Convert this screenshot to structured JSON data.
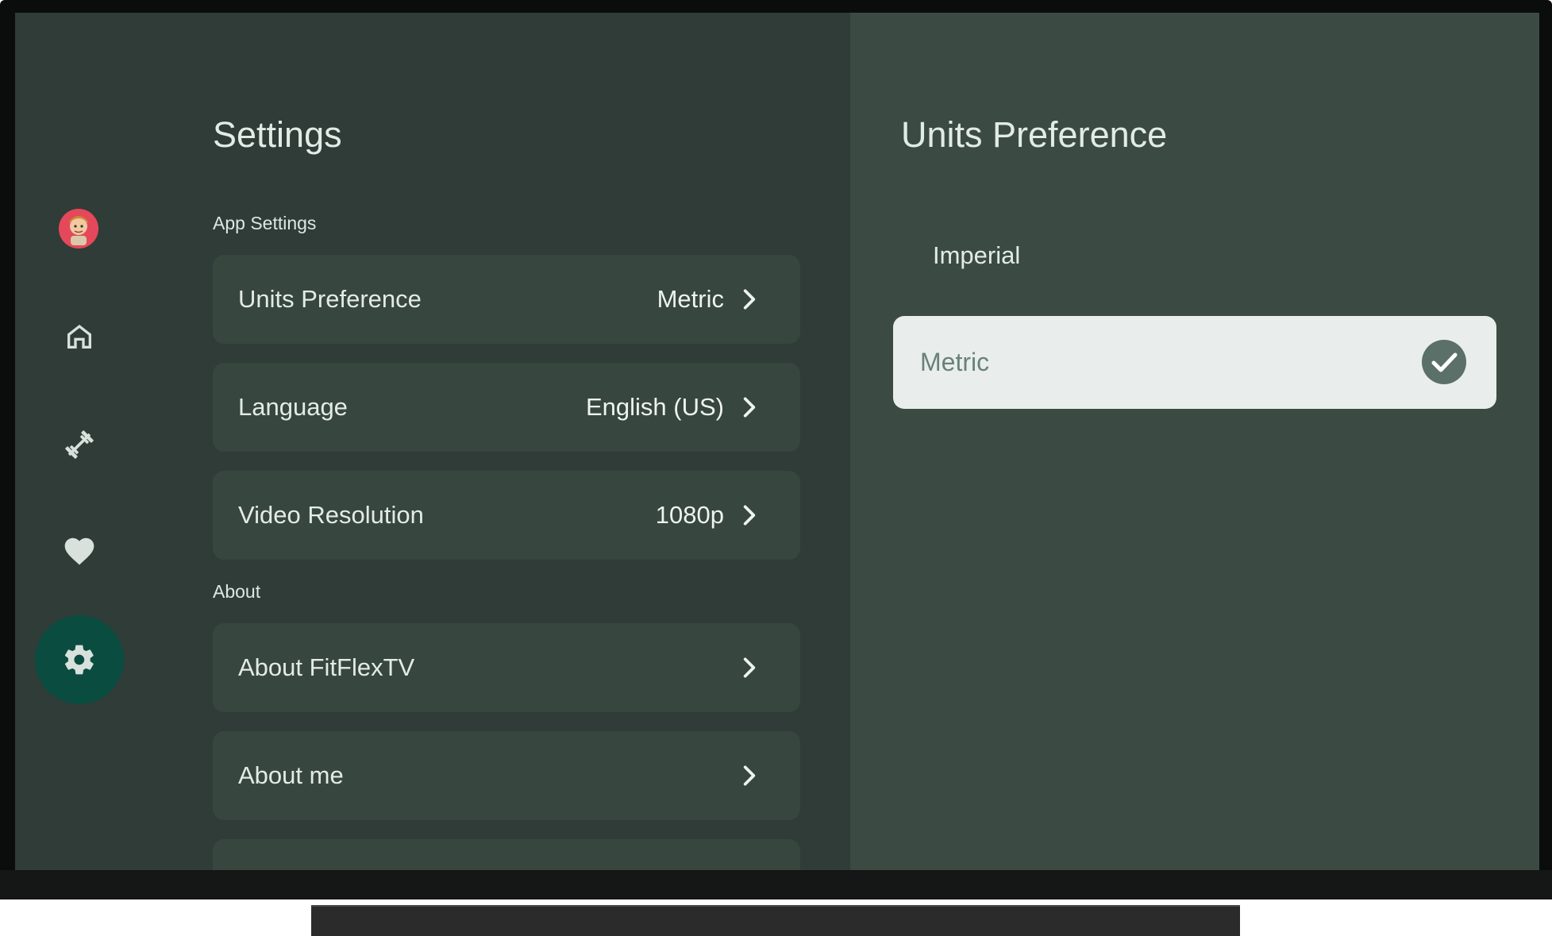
{
  "settings": {
    "title": "Settings",
    "sections": {
      "app_settings": "App Settings",
      "about": "About"
    },
    "items": {
      "units": {
        "label": "Units Preference",
        "value": "Metric"
      },
      "language": {
        "label": "Language",
        "value": "English (US)"
      },
      "video": {
        "label": "Video Resolution",
        "value": "1080p"
      },
      "about_app": {
        "label": "About FitFlexTV"
      },
      "about_me": {
        "label": "About me"
      }
    }
  },
  "nav": {
    "items": [
      "avatar",
      "home-icon",
      "dumbbell-icon",
      "heart-icon",
      "gear-icon"
    ],
    "active": "gear-icon"
  },
  "panel": {
    "title": "Units Preference",
    "options": [
      {
        "label": "Imperial",
        "selected": false
      },
      {
        "label": "Metric",
        "selected": true
      }
    ]
  },
  "colors": {
    "background": "#2f3c37",
    "panel_background": "#3b4b44",
    "card": "#37463f",
    "accent": "#0a4d40",
    "selected_option": "#e9eeec",
    "check": "#5a7069"
  }
}
